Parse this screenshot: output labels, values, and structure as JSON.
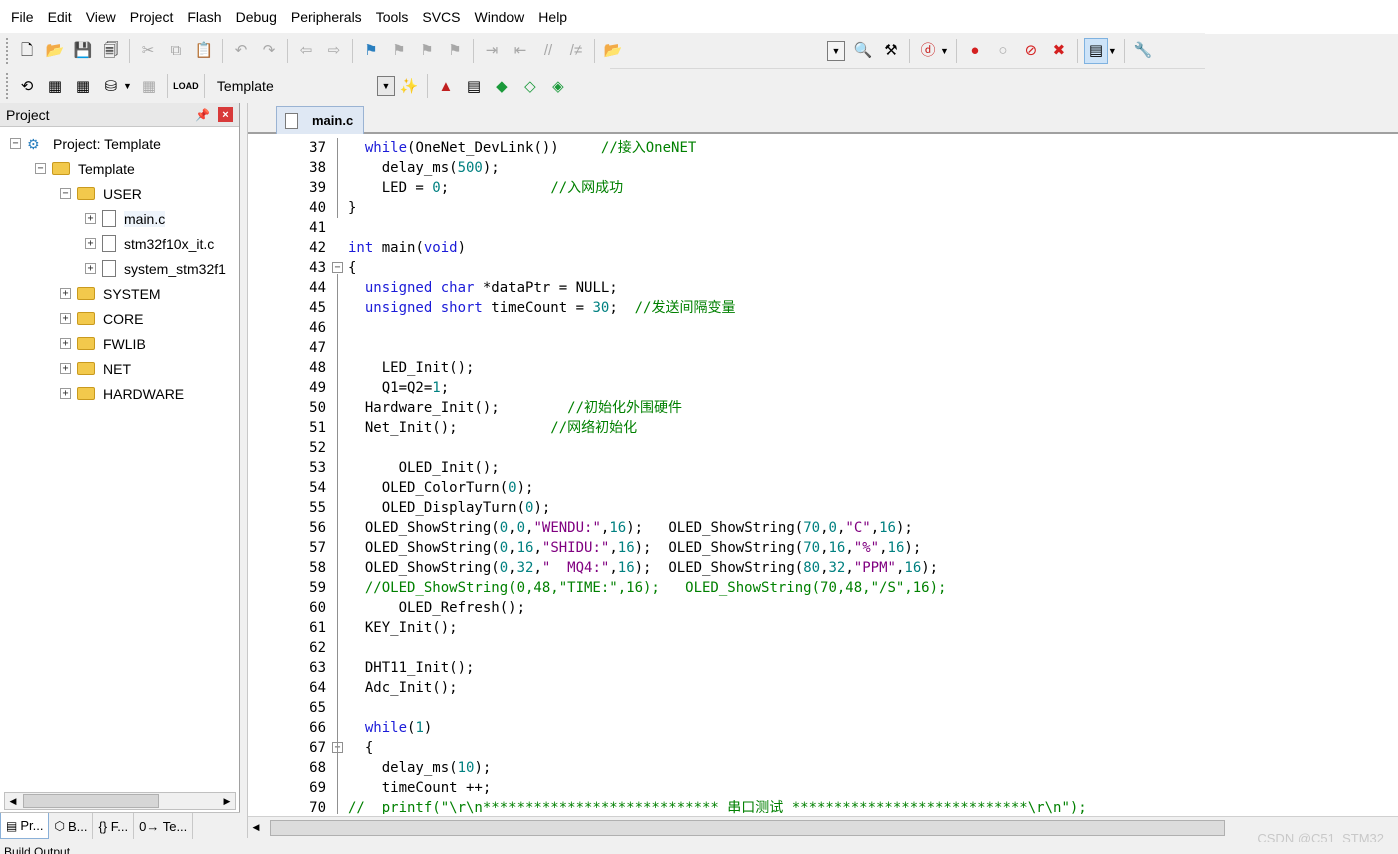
{
  "menu": [
    "File",
    "Edit",
    "View",
    "Project",
    "Flash",
    "Debug",
    "Peripherals",
    "Tools",
    "SVCS",
    "Window",
    "Help"
  ],
  "target_select": "Template",
  "project_panel": {
    "title": "Project",
    "tree": [
      {
        "label": "Project: Template",
        "kind": "project",
        "expander": "−"
      },
      {
        "label": "Template",
        "kind": "target",
        "expander": "−"
      },
      {
        "label": "USER",
        "kind": "folder",
        "expander": "−"
      },
      {
        "label": "main.c",
        "kind": "file",
        "expander": "+"
      },
      {
        "label": "stm32f10x_it.c",
        "kind": "file",
        "expander": "+"
      },
      {
        "label": "system_stm32f1",
        "kind": "file",
        "expander": "+"
      },
      {
        "label": "SYSTEM",
        "kind": "folder",
        "expander": "+"
      },
      {
        "label": "CORE",
        "kind": "folder",
        "expander": "+"
      },
      {
        "label": "FWLIB",
        "kind": "folder",
        "expander": "+"
      },
      {
        "label": "NET",
        "kind": "folder",
        "expander": "+"
      },
      {
        "label": "HARDWARE",
        "kind": "folder",
        "expander": "+"
      }
    ],
    "tabs": [
      "Pr...",
      "B...",
      "{} F...",
      "0→ Te..."
    ]
  },
  "editor": {
    "tab_label": "main.c",
    "lines": [
      {
        "n": "37",
        "segs": [
          [
            "p",
            "  "
          ],
          [
            "k",
            "while"
          ],
          [
            "p",
            "(OneNet_DevLink())     "
          ],
          [
            "c",
            "//接入OneNET"
          ]
        ]
      },
      {
        "n": "38",
        "segs": [
          [
            "p",
            "    delay_ms("
          ],
          [
            "n",
            "500"
          ],
          [
            "p",
            ");"
          ]
        ]
      },
      {
        "n": "39",
        "segs": [
          [
            "p",
            "    LED = "
          ],
          [
            "n",
            "0"
          ],
          [
            "p",
            ";            "
          ],
          [
            "c",
            "//入网成功"
          ]
        ]
      },
      {
        "n": "40",
        "segs": [
          [
            "p",
            "}"
          ]
        ]
      },
      {
        "n": "41",
        "segs": []
      },
      {
        "n": "42",
        "segs": [
          [
            "k",
            "int"
          ],
          [
            "p",
            " main("
          ],
          [
            "k",
            "void"
          ],
          [
            "p",
            ")"
          ]
        ]
      },
      {
        "n": "43",
        "segs": [
          [
            "p",
            "{"
          ]
        ],
        "fold": "−"
      },
      {
        "n": "44",
        "segs": [
          [
            "p",
            "  "
          ],
          [
            "k",
            "unsigned char"
          ],
          [
            "p",
            " *dataPtr = NULL;"
          ]
        ]
      },
      {
        "n": "45",
        "segs": [
          [
            "p",
            "  "
          ],
          [
            "k",
            "unsigned short"
          ],
          [
            "p",
            " timeCount = "
          ],
          [
            "n",
            "30"
          ],
          [
            "p",
            ";  "
          ],
          [
            "c",
            "//发送间隔变量"
          ]
        ]
      },
      {
        "n": "46",
        "segs": []
      },
      {
        "n": "47",
        "segs": []
      },
      {
        "n": "48",
        "segs": [
          [
            "p",
            "    LED_Init();"
          ]
        ]
      },
      {
        "n": "49",
        "segs": [
          [
            "p",
            "    Q1=Q2="
          ],
          [
            "n",
            "1"
          ],
          [
            "p",
            ";"
          ]
        ]
      },
      {
        "n": "50",
        "segs": [
          [
            "p",
            "  Hardware_Init();        "
          ],
          [
            "c",
            "//初始化外围硬件"
          ]
        ]
      },
      {
        "n": "51",
        "segs": [
          [
            "p",
            "  Net_Init();           "
          ],
          [
            "c",
            "//网络初始化"
          ]
        ]
      },
      {
        "n": "52",
        "segs": []
      },
      {
        "n": "53",
        "segs": [
          [
            "p",
            "      OLED_Init();"
          ]
        ]
      },
      {
        "n": "54",
        "segs": [
          [
            "p",
            "    OLED_ColorTurn("
          ],
          [
            "n",
            "0"
          ],
          [
            "p",
            ");"
          ]
        ]
      },
      {
        "n": "55",
        "segs": [
          [
            "p",
            "    OLED_DisplayTurn("
          ],
          [
            "n",
            "0"
          ],
          [
            "p",
            ");"
          ]
        ]
      },
      {
        "n": "56",
        "segs": [
          [
            "p",
            "  OLED_ShowString("
          ],
          [
            "n",
            "0"
          ],
          [
            "p",
            ","
          ],
          [
            "n",
            "0"
          ],
          [
            "p",
            ","
          ],
          [
            "s",
            "\"WENDU:\""
          ],
          [
            "p",
            ","
          ],
          [
            "n",
            "16"
          ],
          [
            "p",
            ");   OLED_ShowString("
          ],
          [
            "n",
            "70"
          ],
          [
            "p",
            ","
          ],
          [
            "n",
            "0"
          ],
          [
            "p",
            ","
          ],
          [
            "s",
            "\"C\""
          ],
          [
            "p",
            ","
          ],
          [
            "n",
            "16"
          ],
          [
            "p",
            ");"
          ]
        ]
      },
      {
        "n": "57",
        "segs": [
          [
            "p",
            "  OLED_ShowString("
          ],
          [
            "n",
            "0"
          ],
          [
            "p",
            ","
          ],
          [
            "n",
            "16"
          ],
          [
            "p",
            ","
          ],
          [
            "s",
            "\"SHIDU:\""
          ],
          [
            "p",
            ","
          ],
          [
            "n",
            "16"
          ],
          [
            "p",
            ");  OLED_ShowString("
          ],
          [
            "n",
            "70"
          ],
          [
            "p",
            ","
          ],
          [
            "n",
            "16"
          ],
          [
            "p",
            ","
          ],
          [
            "s",
            "\"%\""
          ],
          [
            "p",
            ","
          ],
          [
            "n",
            "16"
          ],
          [
            "p",
            ");"
          ]
        ]
      },
      {
        "n": "58",
        "segs": [
          [
            "p",
            "  OLED_ShowString("
          ],
          [
            "n",
            "0"
          ],
          [
            "p",
            ","
          ],
          [
            "n",
            "32"
          ],
          [
            "p",
            ","
          ],
          [
            "s",
            "\"  MQ4:\""
          ],
          [
            "p",
            ","
          ],
          [
            "n",
            "16"
          ],
          [
            "p",
            ");  OLED_ShowString("
          ],
          [
            "n",
            "80"
          ],
          [
            "p",
            ","
          ],
          [
            "n",
            "32"
          ],
          [
            "p",
            ","
          ],
          [
            "s",
            "\"PPM\""
          ],
          [
            "p",
            ","
          ],
          [
            "n",
            "16"
          ],
          [
            "p",
            ");"
          ]
        ]
      },
      {
        "n": "59",
        "segs": [
          [
            "p",
            "  "
          ],
          [
            "c",
            "//OLED_ShowString(0,48,\"TIME:\",16);   OLED_ShowString(70,48,\"/S\",16);"
          ]
        ]
      },
      {
        "n": "60",
        "segs": [
          [
            "p",
            "      OLED_Refresh();"
          ]
        ]
      },
      {
        "n": "61",
        "segs": [
          [
            "p",
            "  KEY_Init();"
          ]
        ]
      },
      {
        "n": "62",
        "segs": []
      },
      {
        "n": "63",
        "segs": [
          [
            "p",
            "  DHT11_Init();"
          ]
        ]
      },
      {
        "n": "64",
        "segs": [
          [
            "p",
            "  Adc_Init();"
          ]
        ]
      },
      {
        "n": "65",
        "segs": []
      },
      {
        "n": "66",
        "segs": [
          [
            "p",
            "  "
          ],
          [
            "k",
            "while"
          ],
          [
            "p",
            "("
          ],
          [
            "n",
            "1"
          ],
          [
            "p",
            ")"
          ]
        ]
      },
      {
        "n": "67",
        "segs": [
          [
            "p",
            "  {"
          ]
        ],
        "fold": "−"
      },
      {
        "n": "68",
        "segs": [
          [
            "p",
            "    delay_ms("
          ],
          [
            "n",
            "10"
          ],
          [
            "p",
            ");"
          ]
        ]
      },
      {
        "n": "69",
        "segs": [
          [
            "p",
            "    timeCount ++;"
          ]
        ]
      },
      {
        "n": "70",
        "segs": [
          [
            "c",
            "//  printf(\"\\r\\n**************************** 串口测试 ****************************\\r\\n\");"
          ]
        ]
      }
    ]
  },
  "watermark": "CSDN @C51_STM32",
  "build_output_label": "Build Output"
}
